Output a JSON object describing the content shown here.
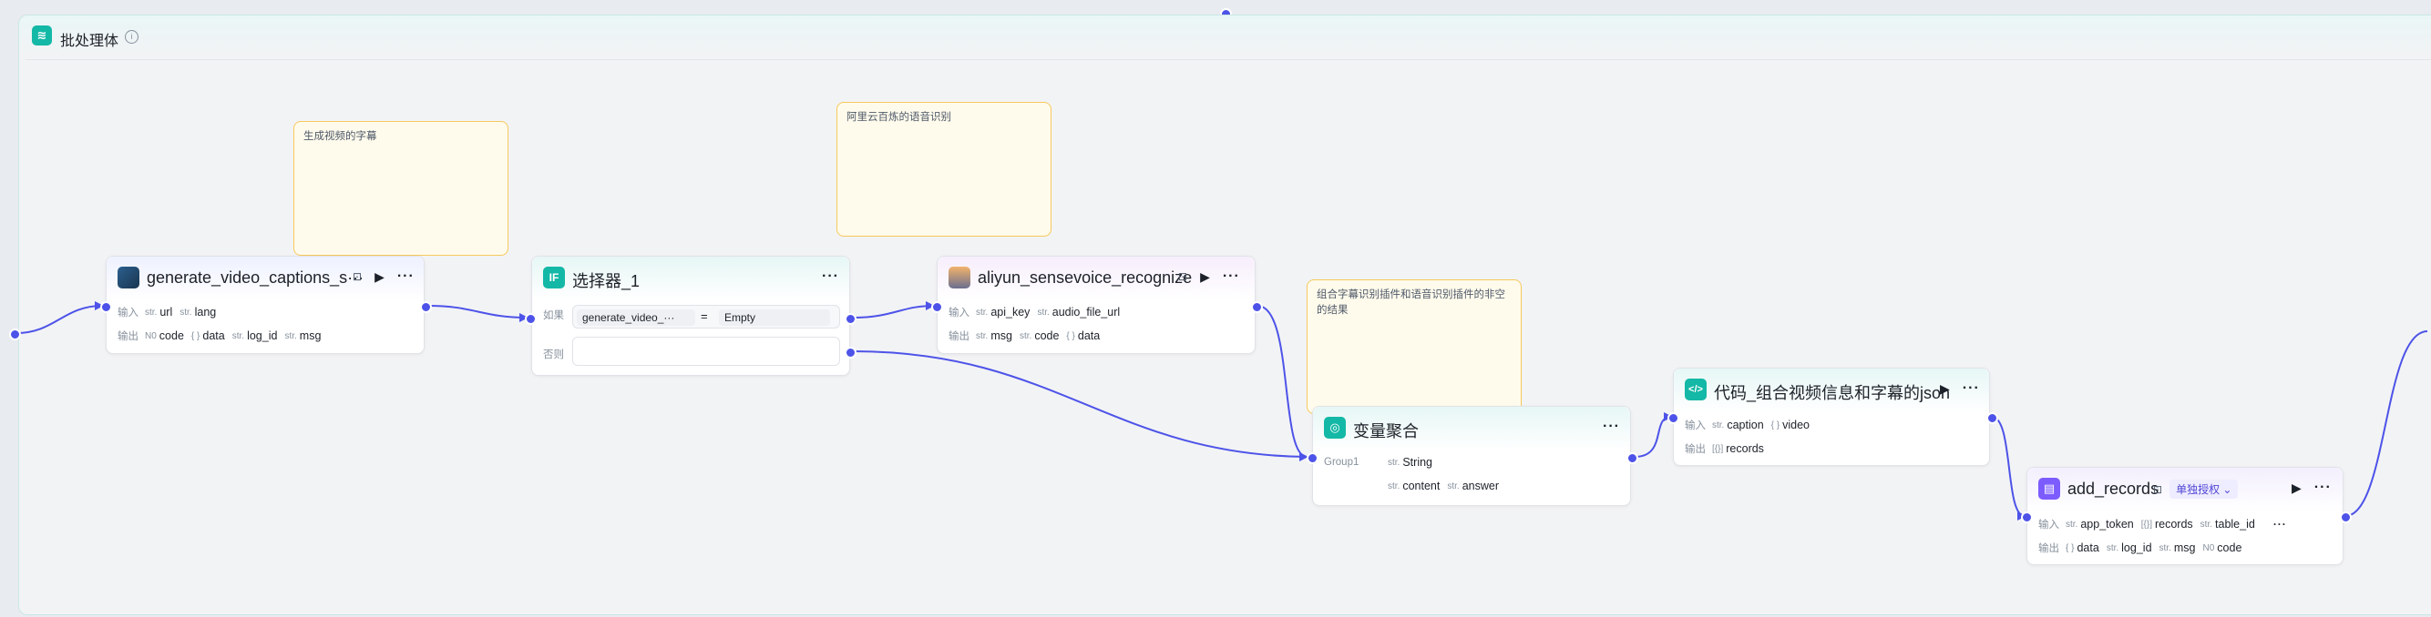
{
  "batch_frame": {
    "title": "批处理体",
    "info_icon": "info-icon",
    "icon": "layers-icon",
    "accent": "#14b8a6"
  },
  "notes": [
    {
      "text": "生成视频的字幕"
    },
    {
      "text": "阿里云百炼的语音识别"
    },
    {
      "text": "组合字幕识别插件和语音识别插件的非空的结果"
    }
  ],
  "nodes": {
    "captions": {
      "title": "generate_video_captions_s···",
      "input_label": "输入",
      "output_label": "输出",
      "inputs": [
        {
          "type": "str.",
          "name": "url"
        },
        {
          "type": "str.",
          "name": "lang"
        }
      ],
      "outputs": [
        {
          "type": "N0",
          "name": "code"
        },
        {
          "type": "{ }",
          "name": "data"
        },
        {
          "type": "str.",
          "name": "log_id"
        },
        {
          "type": "str.",
          "name": "msg"
        }
      ]
    },
    "selector": {
      "title": "选择器_1",
      "icon_text": "IF",
      "if_label": "如果",
      "else_label": "否则",
      "condition_var": "generate_video_···",
      "condition_op": "=",
      "condition_value": "Empty"
    },
    "aliyun": {
      "title": "aliyun_sensevoice_recognize",
      "input_label": "输入",
      "output_label": "输出",
      "inputs": [
        {
          "type": "str.",
          "name": "api_key"
        },
        {
          "type": "str.",
          "name": "audio_file_url"
        }
      ],
      "outputs": [
        {
          "type": "str.",
          "name": "msg"
        },
        {
          "type": "str.",
          "name": "code"
        },
        {
          "type": "{ }",
          "name": "data"
        }
      ]
    },
    "aggregate": {
      "title": "变量聚合",
      "group_label": "Group1",
      "group_type": {
        "type": "str.",
        "name": "String"
      },
      "vars": [
        {
          "type": "str.",
          "name": "content"
        },
        {
          "type": "str.",
          "name": "answer"
        }
      ]
    },
    "code": {
      "title": "代码_组合视频信息和字幕的json",
      "input_label": "输入",
      "output_label": "输出",
      "inputs": [
        {
          "type": "str.",
          "name": "caption"
        },
        {
          "type": "{ }",
          "name": "video"
        }
      ],
      "outputs": [
        {
          "type": "[{}]",
          "name": "records"
        }
      ]
    },
    "records": {
      "title": "add_records",
      "auth": "单独授权",
      "input_label": "输入",
      "output_label": "输出",
      "inputs": [
        {
          "type": "str.",
          "name": "app_token"
        },
        {
          "type": "[{}]",
          "name": "records"
        },
        {
          "type": "str.",
          "name": "table_id"
        }
      ],
      "outputs": [
        {
          "type": "{ }",
          "name": "data"
        },
        {
          "type": "str.",
          "name": "log_id"
        },
        {
          "type": "str.",
          "name": "msg"
        },
        {
          "type": "N0",
          "name": "code"
        }
      ]
    }
  },
  "colors": {
    "edge": "#4d53e8",
    "note_border": "#f7c95c",
    "note_fill": "#fffbec",
    "selector_icon": "#14b8a6",
    "aggregate_icon": "#14b8a6",
    "code_icon": "#14b8a6",
    "records_icon": "#7c5cff"
  },
  "icons": {
    "play": "▶",
    "more": "···",
    "plugin_badge": "plugin-icon",
    "chevron": "chevron-down-icon"
  }
}
